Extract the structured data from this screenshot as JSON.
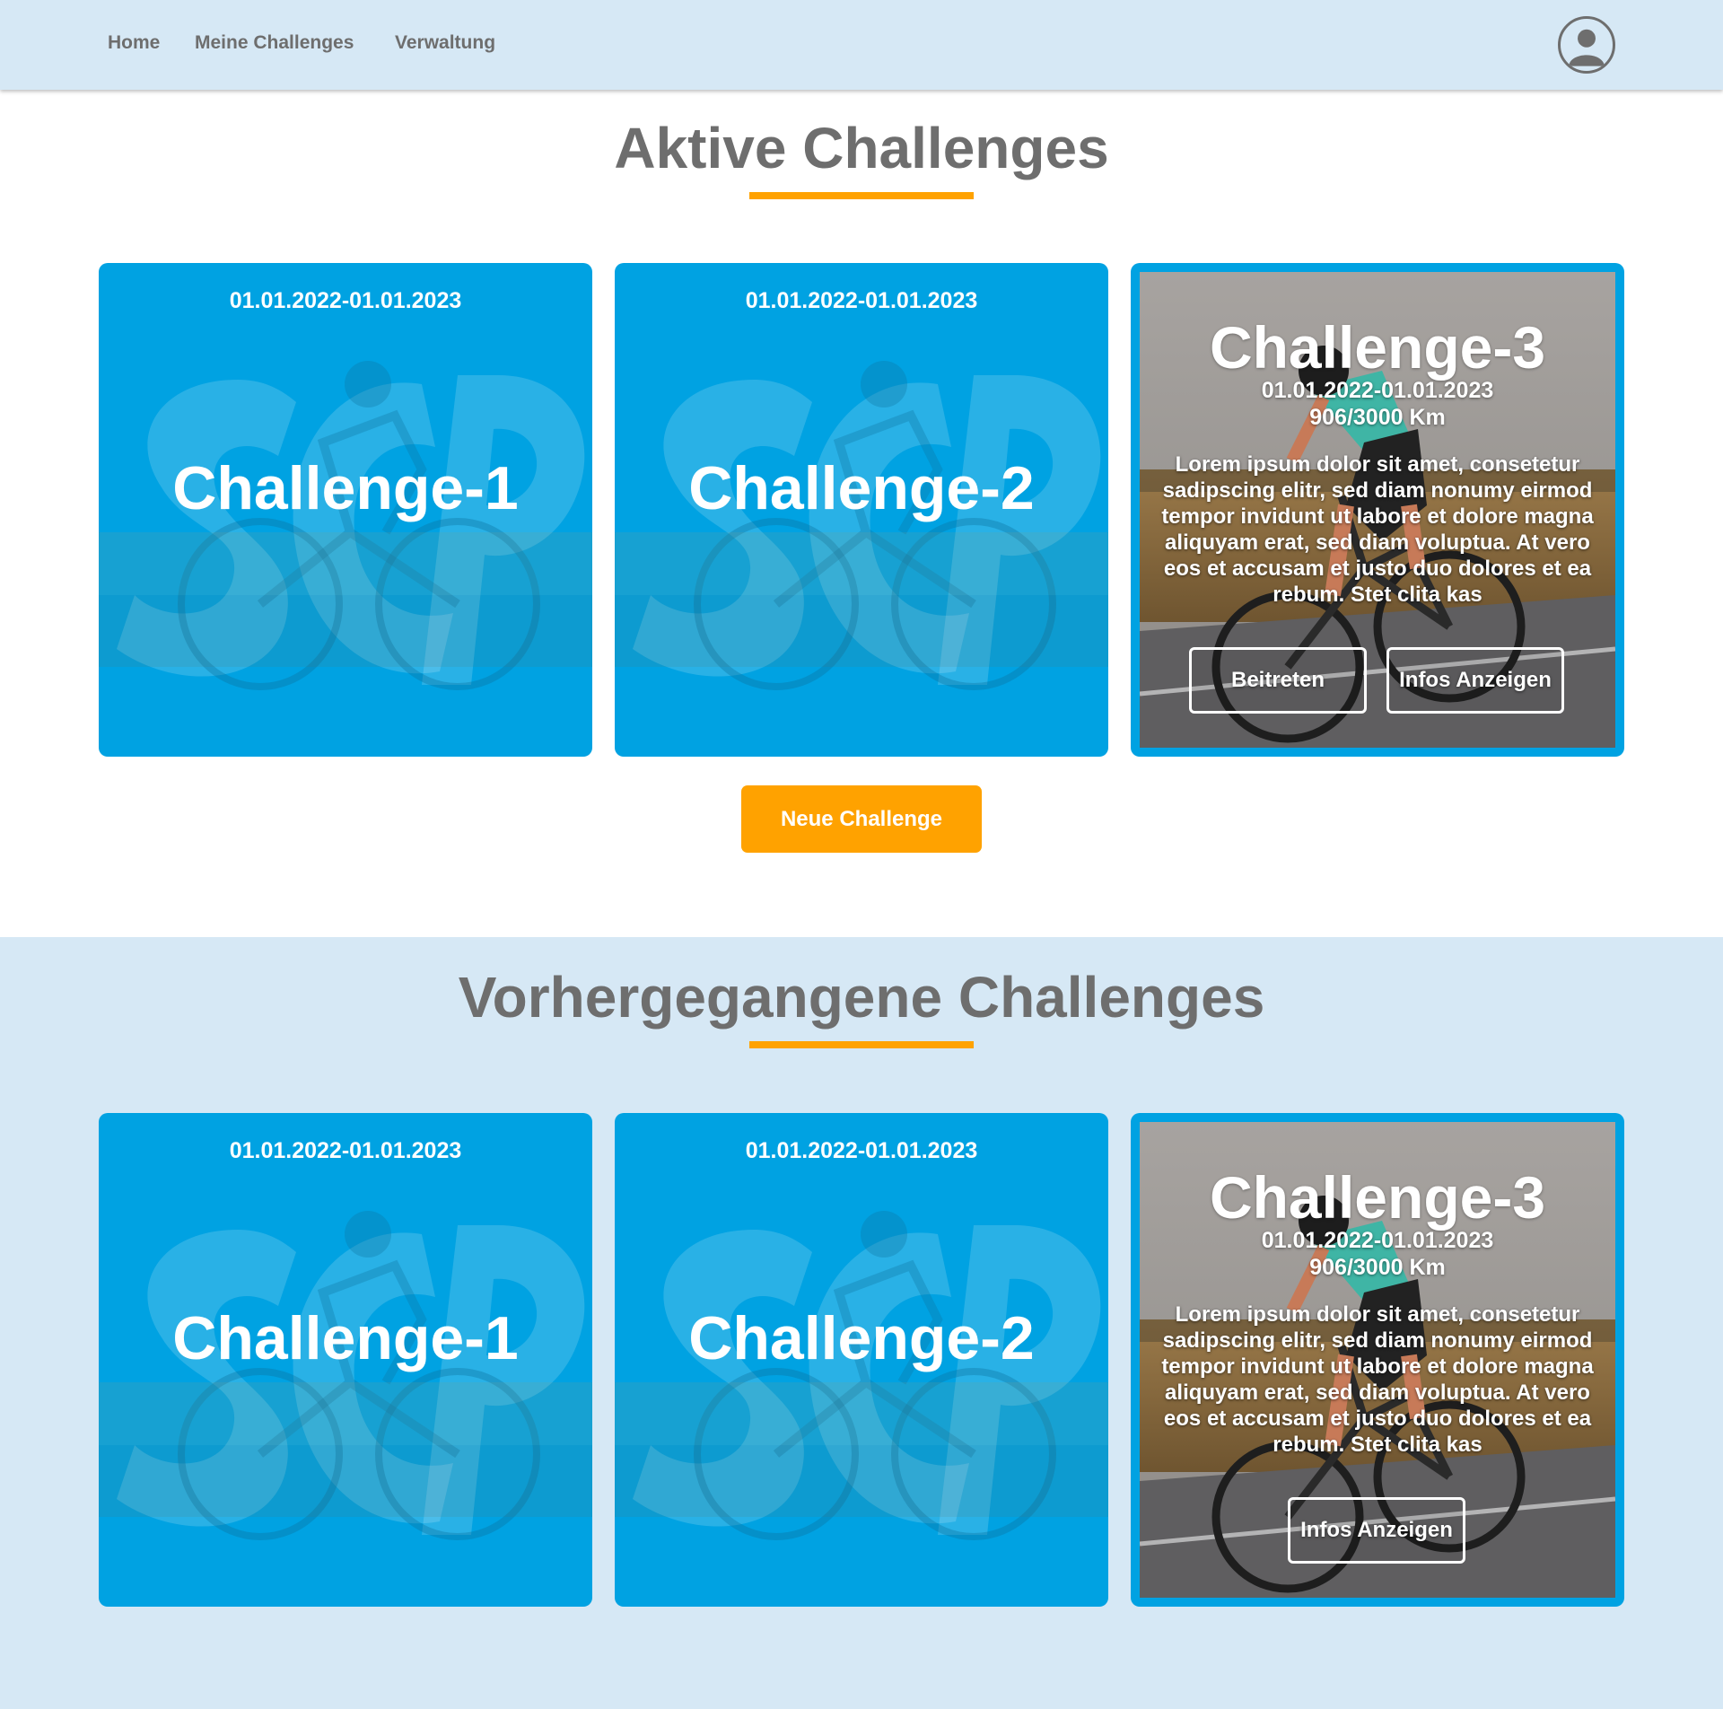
{
  "colors": {
    "nav_bg": "#d6e8f5",
    "card_blue": "#00a2e2",
    "accent_orange": "#ffa200",
    "heading_gray": "#6e6e6e"
  },
  "nav": {
    "links": [
      "Home",
      "Meine Challenges",
      "Verwaltung"
    ],
    "profile_icon": "user-avatar-icon"
  },
  "active": {
    "heading": "Aktive Challenges",
    "cards": [
      {
        "date": "01.01.2022-01.01.2023",
        "title": "Challenge-1"
      },
      {
        "date": "01.01.2022-01.01.2023",
        "title": "Challenge-2"
      }
    ],
    "featured": {
      "title": "Challenge-3",
      "date": "01.01.2022-01.01.2023",
      "distance": "906/3000 Km",
      "description": "Lorem ipsum dolor sit amet, consetetur sadipscing elitr, sed diam nonumy eirmod tempor invidunt ut labore et dolore magna aliquyam erat, sed diam voluptua. At vero eos et accusam et justo duo dolores et ea rebum. Stet clita kas",
      "join_label": "Beitreten",
      "info_label": "Infos Anzeigen"
    },
    "new_button": "Neue Challenge"
  },
  "previous": {
    "heading": "Vorhergegangene Challenges",
    "cards": [
      {
        "date": "01.01.2022-01.01.2023",
        "title": "Challenge-1"
      },
      {
        "date": "01.01.2022-01.01.2023",
        "title": "Challenge-2"
      }
    ],
    "featured": {
      "title": "Challenge-3",
      "date": "01.01.2022-01.01.2023",
      "distance": "906/3000 Km",
      "description": "Lorem ipsum dolor sit amet, consetetur sadipscing elitr, sed diam nonumy eirmod tempor invidunt ut labore et dolore magna aliquyam erat, sed diam voluptua. At vero eos et accusam et justo duo dolores et ea rebum. Stet clita kas",
      "info_label": "Infos Anzeigen"
    }
  }
}
